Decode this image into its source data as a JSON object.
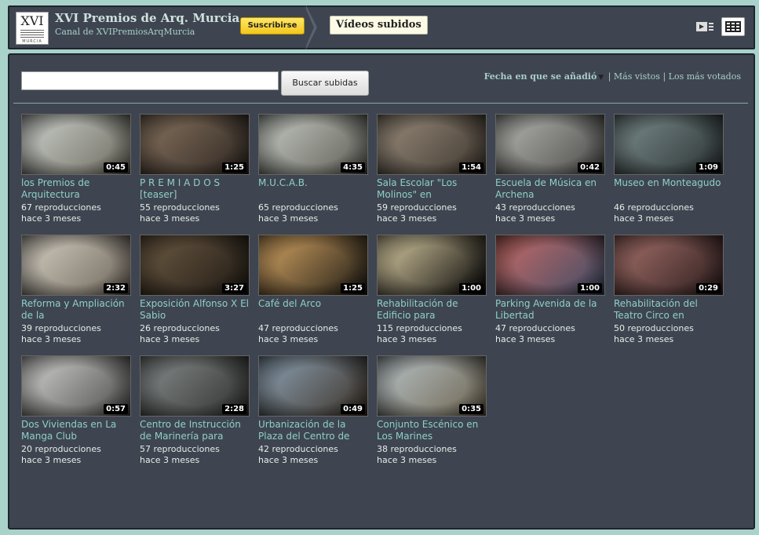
{
  "header": {
    "logo_text": "XVI",
    "logo_subtext": "MURCIA",
    "channel_title": "XVI Premios de Arq. Murcia",
    "channel_subtitle": "Canal de XVIPremiosArqMurcia",
    "subscribe_label": "Suscribirse",
    "active_tab": "Vídeos subidos",
    "view_icons": [
      "play-list-icon",
      "grid-view-icon"
    ]
  },
  "search": {
    "value": "",
    "button_label": "Buscar subidas"
  },
  "sort": {
    "active": "Fecha en que se añadió",
    "options": [
      "Más vistos",
      "Los más votados"
    ],
    "separator": "|"
  },
  "videos": [
    {
      "title": "los Premios de Arquitectura",
      "views": "67 reproducciones",
      "date": "hace 3 meses",
      "duration": "0:45",
      "colors": [
        "#cfd3cf",
        "#6c6a5e"
      ]
    },
    {
      "title": "P R E M I A D O S [teaser]",
      "views": "55 reproducciones",
      "date": "hace 3 meses",
      "duration": "1:25",
      "colors": [
        "#8a7561",
        "#2c2520"
      ]
    },
    {
      "title": "M.U.C.A.B.",
      "views": "65 reproducciones",
      "date": "hace 3 meses",
      "duration": "4:35",
      "colors": [
        "#c9cdc6",
        "#5d5d55"
      ]
    },
    {
      "title": "Sala Escolar \"Los Molinos\" en",
      "views": "59 reproducciones",
      "date": "hace 3 meses",
      "duration": "1:54",
      "colors": [
        "#9a8d7c",
        "#3e372f"
      ]
    },
    {
      "title": "Escuela de Música en Archena",
      "views": "43 reproducciones",
      "date": "hace 3 meses",
      "duration": "0:42",
      "colors": [
        "#b8b9b4",
        "#4a4b48"
      ]
    },
    {
      "title": "Museo en Monteagudo",
      "views": "46 reproducciones",
      "date": "hace 3 meses",
      "duration": "1:09",
      "colors": [
        "#7e8f8f",
        "#2a3132"
      ]
    },
    {
      "title": "Reforma y Ampliación de la",
      "views": "39 reproducciones",
      "date": "hace 3 meses",
      "duration": "2:32",
      "colors": [
        "#d8d2c6",
        "#6d655a"
      ]
    },
    {
      "title": "Exposición Alfonso X El Sabio",
      "views": "26 reproducciones",
      "date": "hace 3 meses",
      "duration": "3:27",
      "colors": [
        "#6f5c45",
        "#1e1913"
      ]
    },
    {
      "title": "Café del Arco",
      "views": "47 reproducciones",
      "date": "hace 3 meses",
      "duration": "1:25",
      "colors": [
        "#d9a866",
        "#1d1a14"
      ]
    },
    {
      "title": "Rehabilitación de Edificio para",
      "views": "115 reproducciones",
      "date": "hace 3 meses",
      "duration": "1:00",
      "colors": [
        "#e0d2a8",
        "#050505"
      ]
    },
    {
      "title": "Parking Avenida de la Libertad",
      "views": "47 reproducciones",
      "date": "hace 3 meses",
      "duration": "1:00",
      "colors": [
        "#c96b66",
        "#3d4c66"
      ]
    },
    {
      "title": "Rehabilitación del Teatro Circo en",
      "views": "50 reproducciones",
      "date": "hace 3 meses",
      "duration": "0:29",
      "colors": [
        "#a8726c",
        "#2a1c1c"
      ]
    },
    {
      "title": "Dos Viviendas en La Manga Club",
      "views": "20 reproducciones",
      "date": "hace 3 meses",
      "duration": "0:57",
      "colors": [
        "#d7d8d6",
        "#4a4b49"
      ]
    },
    {
      "title": "Centro de Instrucción de Marinería para",
      "views": "57 reproducciones",
      "date": "hace 3 meses",
      "duration": "2:28",
      "colors": [
        "#8a8f8f",
        "#2e2f2d"
      ]
    },
    {
      "title": "Urbanización de la Plaza del Centro de",
      "views": "42 reproducciones",
      "date": "hace 3 meses",
      "duration": "0:49",
      "colors": [
        "#8fa4b6",
        "#3b3127"
      ]
    },
    {
      "title": "Conjunto Escénico en Los Marines",
      "views": "38 reproducciones",
      "date": "hace 3 meses",
      "duration": "0:35",
      "colors": [
        "#b9c4c9",
        "#6d6450"
      ]
    }
  ]
}
